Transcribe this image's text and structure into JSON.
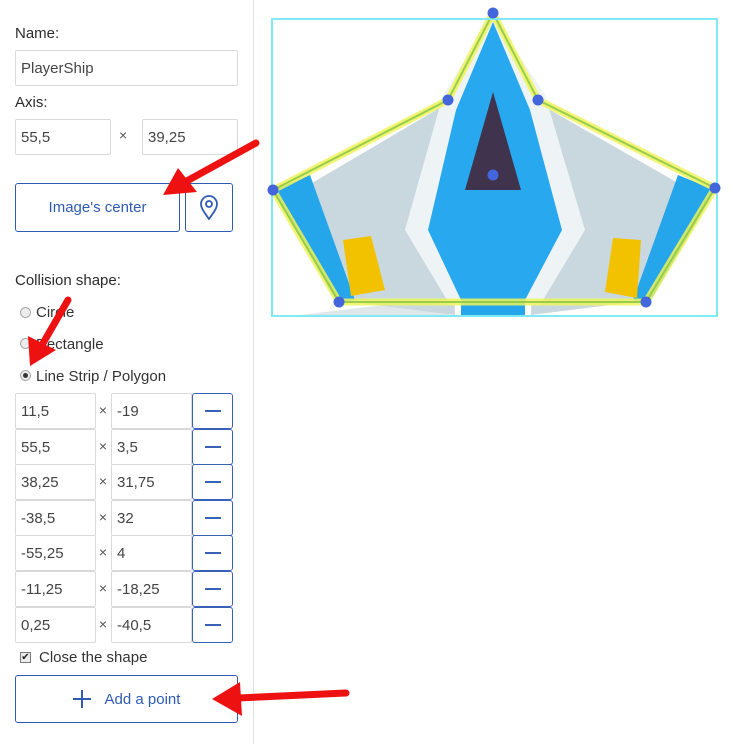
{
  "properties": {
    "name_label": "Name:",
    "name_value": "PlayerShip",
    "axis_label": "Axis:",
    "axis_x": "55,5",
    "axis_y": "39,25",
    "times_symbol": "×",
    "image_center_label": "Image's center",
    "pin_icon": "map-pin-icon"
  },
  "collision": {
    "label": "Collision shape:",
    "options": [
      {
        "label": "Circle",
        "checked": false
      },
      {
        "label": "Rectangle",
        "checked": false
      },
      {
        "label": "Line Strip / Polygon",
        "checked": true
      }
    ],
    "points": [
      {
        "x": "11,5",
        "y": "-19"
      },
      {
        "x": "55,5",
        "y": "3,5"
      },
      {
        "x": "38,25",
        "y": "31,75"
      },
      {
        "x": "-38,5",
        "y": "32"
      },
      {
        "x": "-55,25",
        "y": "4"
      },
      {
        "x": "-11,25",
        "y": "-18,25"
      },
      {
        "x": "0,25",
        "y": "-40,5"
      }
    ],
    "close_shape_label": "Close the shape",
    "close_shape_checked": true,
    "add_point_label": "Add a point"
  },
  "colors": {
    "accent": "#2f5bb5",
    "arrow": "#ee1111",
    "handle": "#4466dd",
    "frame": "#7fe9f5",
    "outline": "#eef35a"
  }
}
